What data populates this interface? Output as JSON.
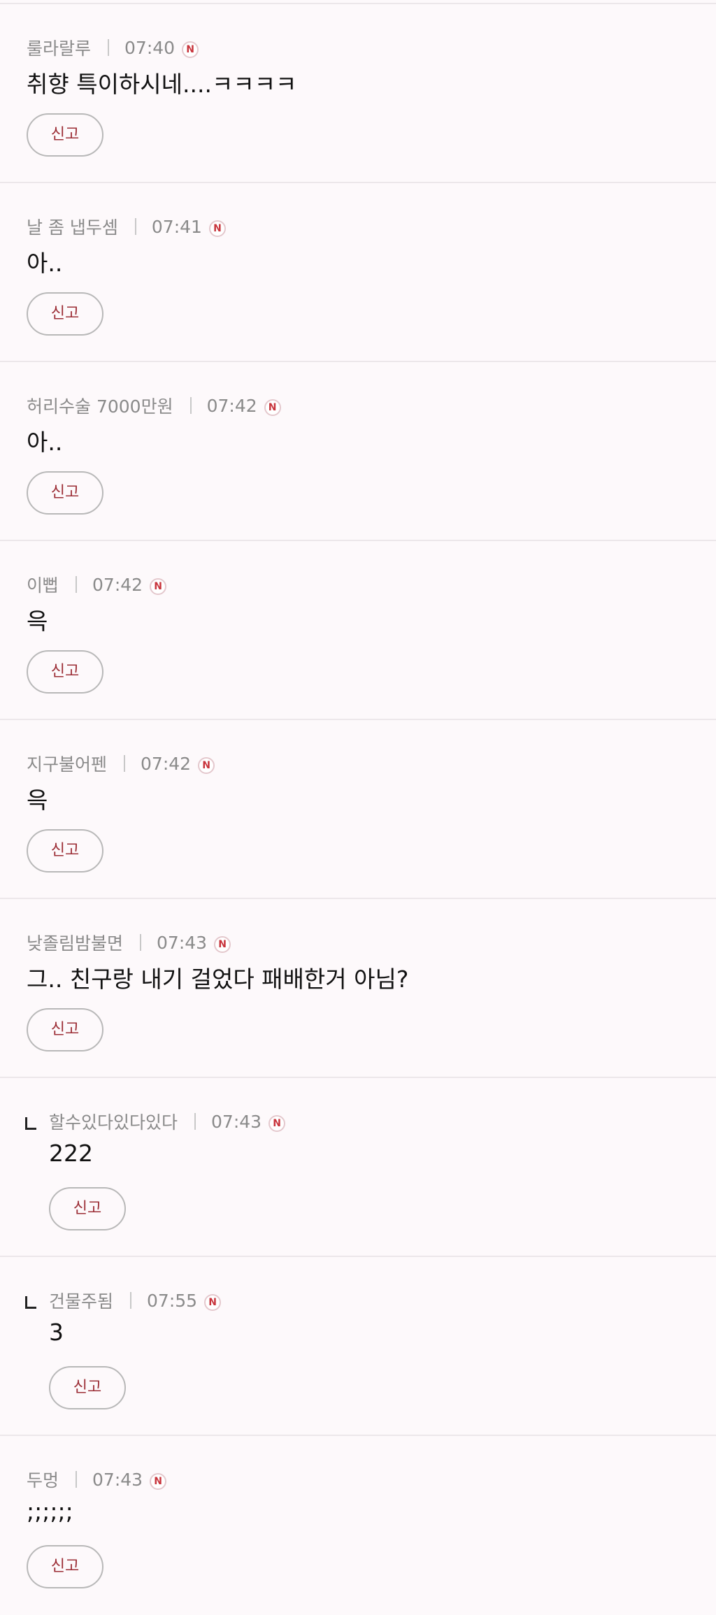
{
  "comments": [
    {
      "author": "룰라랄루",
      "time": "07:40",
      "badge": "N",
      "text": "취향 특이하시네....ㅋㅋㅋㅋ",
      "report": "신고",
      "reply": false
    },
    {
      "author": "날 좀 냅두셈",
      "time": "07:41",
      "badge": "N",
      "text": "아..",
      "report": "신고",
      "reply": false
    },
    {
      "author": "허리수술 7000만원",
      "time": "07:42",
      "badge": "N",
      "text": "아..",
      "report": "신고",
      "reply": false
    },
    {
      "author": "이뻡",
      "time": "07:42",
      "badge": "N",
      "text": "윽",
      "report": "신고",
      "reply": false
    },
    {
      "author": "지구불어펜",
      "time": "07:42",
      "badge": "N",
      "text": "윽",
      "report": "신고",
      "reply": false
    },
    {
      "author": "낮졸림밤불면",
      "time": "07:43",
      "badge": "N",
      "text": "그.. 친구랑 내기 걸었다 패배한거 아님?",
      "report": "신고",
      "reply": false
    },
    {
      "author": "할수있다있다있다",
      "time": "07:43",
      "badge": "N",
      "text": "222",
      "report": "신고",
      "reply": true
    },
    {
      "author": "건물주됨",
      "time": "07:55",
      "badge": "N",
      "text": "3",
      "report": "신고",
      "reply": true
    },
    {
      "author": "두멍",
      "time": "07:43",
      "badge": "N",
      "text": ";;;;;;",
      "report": "신고",
      "reply": false
    }
  ]
}
